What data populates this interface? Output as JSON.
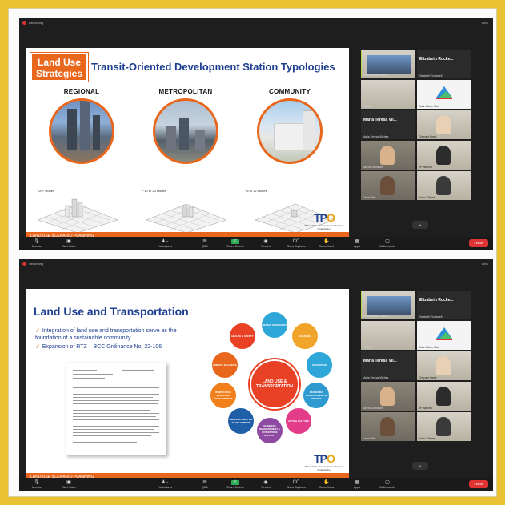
{
  "meeting": {
    "recording_label": "Recording",
    "view_label": "View"
  },
  "slide1": {
    "badge": "Land Use Strategies",
    "title": "Transit-Oriented Development Station Typologies",
    "columns": [
      {
        "label": "REGIONAL",
        "stories": "~20+ stories"
      },
      {
        "label": "METROPOLITAN",
        "stories": "~10 to 20 stories"
      },
      {
        "label": "COMMUNITY",
        "stories": "~6 to 12 stories"
      }
    ],
    "footer": "LAND USE SCENARIO PLANNING",
    "logo": {
      "t": "TP",
      "o": "O",
      "sub": "Miami-Dade Transportation Planning Organization"
    }
  },
  "slide2": {
    "title": "Land Use and Transportation",
    "bullets": [
      "Integration of land use and transportation serve as the foundation of a sustainable community",
      "Expansion of RTZ – BCC Ordinance No. 22-106"
    ],
    "hub": "LAND USE & TRANSPORTATION",
    "nodes": [
      "DESIGN STANDARDS",
      "HOUSING",
      "EDUCATION",
      "ECONOMIC DEVELOPMENT & FINANCE",
      "ARTS & CULTURE",
      "BUSINESS DEVELOPMENT & ENTERPRISE SUPPORT",
      "INDUSTRY SECTOR DEVELOPMENT",
      "WORKFORCE ECONOMIC DEVELOPMENT",
      "ENERGY & CLIMATE",
      "HEALTH & SAFETY"
    ],
    "footer": "LAND USE SCENARIO PLANNING"
  },
  "participants": [
    {
      "name": "Maria Teresa Vilch...",
      "type": "video",
      "speaking": true
    },
    {
      "name": "Elizabeth Rockwell",
      "big": "Elizabeth Rocke...",
      "type": "name"
    },
    {
      "name": "Poshoh",
      "type": "video"
    },
    {
      "name": "Rahn Marin Rice",
      "type": "logo"
    },
    {
      "name": "Maria Teresa Vilchez",
      "big": "Maria Teresa Vil...",
      "type": "name"
    },
    {
      "name": "Chenaie Reed",
      "type": "video"
    },
    {
      "name": "Valeria Decisum",
      "type": "video"
    },
    {
      "name": "JP Wenzel",
      "type": "video"
    },
    {
      "name": "Dana Little",
      "type": "video"
    },
    {
      "name": "John L Teime",
      "type": "video"
    }
  ],
  "toolbar": {
    "unmute": "Unmute",
    "start_video": "Start Video",
    "participants": "Participants",
    "participants_count": "42",
    "qa": "Q&A",
    "share_screen": "Share Screen",
    "record": "Record",
    "show_captions": "Show Captions",
    "raise_hand": "Raise Hand",
    "apps": "Apps",
    "whiteboards": "Whiteboards",
    "end": "Leave"
  },
  "colors": {
    "accent": "#e8671c",
    "navy": "#1e3f91",
    "share": "#2fae57",
    "end": "#dd3333",
    "border": "#e8c232"
  }
}
